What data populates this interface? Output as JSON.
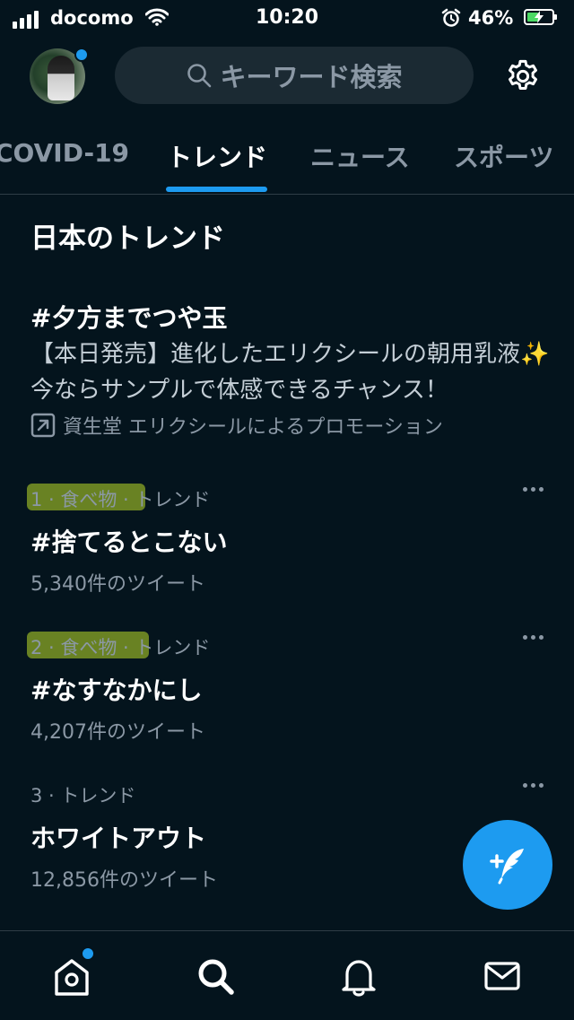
{
  "status_bar": {
    "carrier": "docomo",
    "time": "10:20",
    "battery_percent_text": "46%",
    "battery_level": 0.46
  },
  "header": {
    "search_placeholder": "キーワード検索"
  },
  "tabs": [
    {
      "label": "COVID-19",
      "active": false
    },
    {
      "label": "トレンド",
      "active": true
    },
    {
      "label": "ニュース",
      "active": false
    },
    {
      "label": "スポーツ",
      "active": false
    }
  ],
  "section_title": "日本のトレンド",
  "promoted": {
    "title": "#夕方までつや玉",
    "description": "【本日発売】進化したエリクシールの朝用乳液✨今ならサンプルで体感できるチャンス！",
    "promoted_by": "資生堂 エリクシールによるプロモーション"
  },
  "trends": [
    {
      "meta": "1 · 食べ物 · トレンド",
      "name": "#捨てるとこない",
      "count": "5,340件のツイート",
      "highlighted": true
    },
    {
      "meta": "2 · 食べ物 · トレンド",
      "name": "#なすなかにし",
      "count": "4,207件のツイート",
      "highlighted": true
    },
    {
      "meta": "3 · トレンド",
      "name": "ホワイトアウト",
      "count": "12,856件のツイート",
      "highlighted": false
    }
  ],
  "icons": {
    "search": "search-icon",
    "settings": "gear-icon",
    "compose": "compose-tweet-icon",
    "home": "home-icon",
    "explore": "search-icon",
    "notifications": "bell-icon",
    "messages": "mail-icon",
    "promoted": "promoted-arrow-icon",
    "more": "more-options-icon"
  },
  "colors": {
    "background": "#04141d",
    "accent": "#1d9bf0",
    "secondary_text": "#8b98a5",
    "highlight_marker": "#bedc28"
  }
}
